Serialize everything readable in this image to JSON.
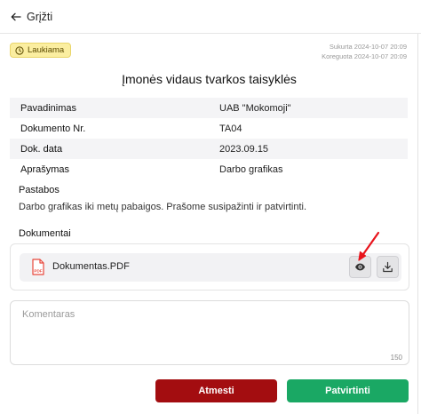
{
  "nav": {
    "back_label": "Grįžti"
  },
  "status": {
    "label": "Laukiama"
  },
  "meta": {
    "created": "Sukurta 2024-10-07 20:09",
    "modified": "Koreguota 2024-10-07 20:09"
  },
  "document": {
    "title": "Įmonės vidaus tvarkos taisyklės",
    "fields": [
      {
        "label": "Pavadinimas",
        "value": "UAB \"Mokomoji\""
      },
      {
        "label": "Dokumento Nr.",
        "value": "TA04"
      },
      {
        "label": "Dok. data",
        "value": "2023.09.15"
      },
      {
        "label": "Aprašymas",
        "value": "Darbo grafikas"
      }
    ],
    "notes_label": "Pastabos",
    "notes_text": "Darbo grafikas iki metų pabaigos. Prašome susipažinti ir patvirtinti.",
    "attachments_label": "Dokumentai",
    "attachments": [
      {
        "name": "Dokumentas.PDF",
        "type_label": "PDF"
      }
    ]
  },
  "comment": {
    "placeholder": "Komentaras",
    "value": "",
    "counter": "150"
  },
  "actions": {
    "reject_label": "Atmesti",
    "confirm_label": "Patvirtinti"
  },
  "colors": {
    "reject": "#a30d10",
    "confirm": "#1aa864",
    "badge_bg": "#fbeea0",
    "pdf": "#e8483c",
    "annotation_arrow": "#e8141c"
  },
  "icons": {
    "back": "arrow-left-icon",
    "status": "clock-icon",
    "file": "pdf-file-icon",
    "preview": "eye-icon",
    "download": "download-icon"
  }
}
